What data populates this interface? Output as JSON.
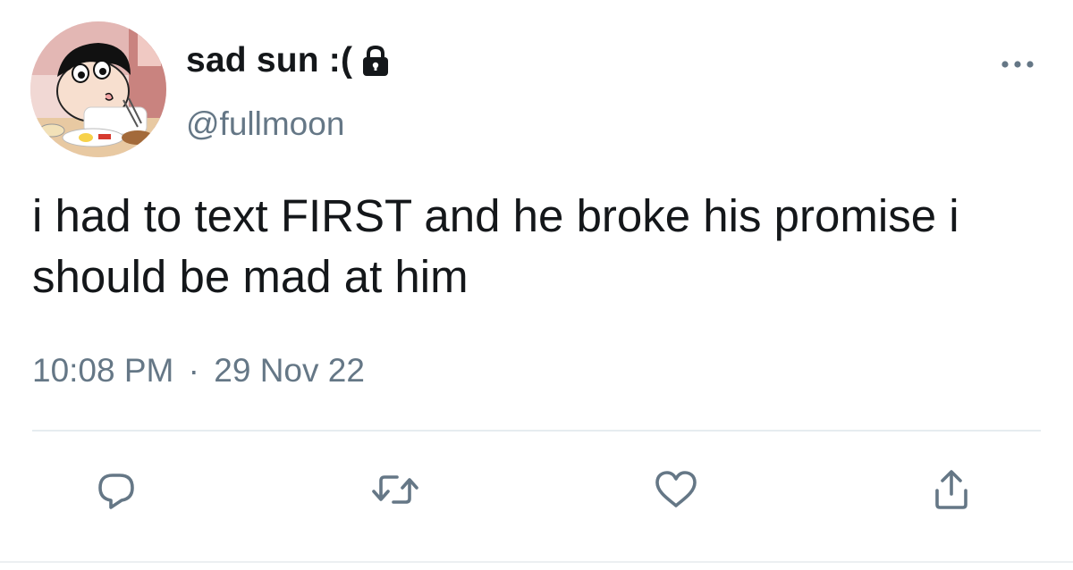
{
  "tweet": {
    "display_name": "sad sun :(",
    "protected": true,
    "handle": "@fullmoon",
    "text": "i had to text FIRST and he broke his promise i should be mad at him",
    "time": "10:08 PM",
    "separator": "·",
    "date": "29 Nov 22"
  },
  "icons": {
    "lock": "lock-icon",
    "more": "more-horizontal-icon",
    "reply": "reply-bubble-icon",
    "retweet": "retweet-icon",
    "like": "heart-icon",
    "share": "share-upload-icon"
  },
  "colors": {
    "text": "#14171a",
    "secondary": "#657786",
    "icon": "#657786",
    "divider": "#e6ecf0",
    "background": "#ffffff"
  }
}
